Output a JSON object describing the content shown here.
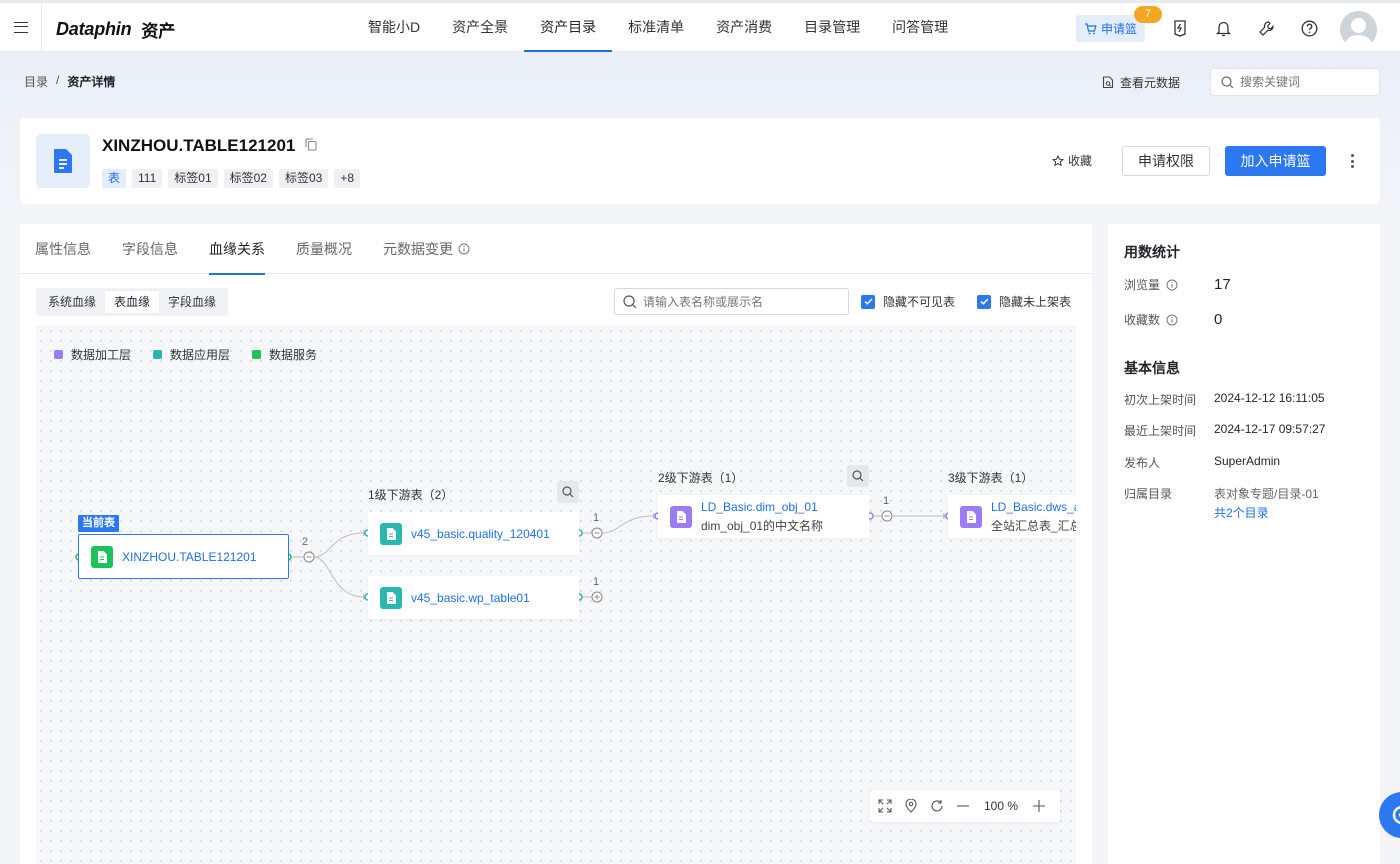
{
  "brand": {
    "name": "Dataphin",
    "sub": "资产"
  },
  "nav": {
    "items": [
      "智能小D",
      "资产全景",
      "资产目录",
      "标准清单",
      "资产消费",
      "目录管理",
      "问答管理"
    ],
    "active": "资产目录"
  },
  "toolbar": {
    "cart_label": "申请篮",
    "cart_badge": "7"
  },
  "breadcrumb": {
    "root": "目录",
    "sep": "/",
    "current": "资产详情"
  },
  "meta_link": "查看元数据",
  "top_search": {
    "placeholder": "搜索关键词"
  },
  "asset": {
    "title": "XINZHOU.TABLE121201",
    "tags": [
      "表",
      "111",
      "标签01",
      "标签02",
      "标签03",
      "+8"
    ],
    "fav_label": "收藏",
    "perm_label": "申请权限",
    "add_label": "加入申请篮"
  },
  "tabs": [
    "属性信息",
    "字段信息",
    "血缘关系",
    "质量概况",
    "元数据变更"
  ],
  "active_tab": "血缘关系",
  "lineage_modes": [
    "系统血缘",
    "表血缘",
    "字段血缘"
  ],
  "active_mode": "表血缘",
  "graph_search": {
    "placeholder": "请输入表名称或展示名"
  },
  "checks": {
    "hide_invisible": "隐藏不可见表",
    "hide_unlisted": "隐藏未上架表"
  },
  "legend": [
    {
      "label": "数据加工层",
      "color": "#9b7cf4"
    },
    {
      "label": "数据应用层",
      "color": "#2ab7b0"
    },
    {
      "label": "数据服务",
      "color": "#1ec25a"
    }
  ],
  "graph": {
    "current_label": "当前表",
    "current_node": "XINZHOU.TABLE121201",
    "level1": {
      "title": "1级下游表（2）",
      "nodes": [
        "v45_basic.quality_120401",
        "v45_basic.wp_table01"
      ]
    },
    "level2": {
      "title": "2级下游表（1）",
      "node_name": "LD_Basic.dim_obj_01",
      "node_sub": "dim_obj_01的中文名称"
    },
    "level3": {
      "title": "3级下游表（1）",
      "node_name": "LD_Basic.dws_a",
      "node_sub": "全站汇总表_汇总"
    },
    "counts": {
      "root": "2",
      "quality": "1",
      "wp": "1",
      "dim": "1"
    }
  },
  "zoom": {
    "value": "100",
    "unit": "%"
  },
  "usage": {
    "title": "用数统计",
    "views_label": "浏览量",
    "views": "17",
    "favs_label": "收藏数",
    "favs": "0"
  },
  "basic": {
    "title": "基本信息",
    "first_listed_label": "初次上架时间",
    "first_listed": "2024-12-12 16:11:05",
    "last_listed_label": "最近上架时间",
    "last_listed": "2024-12-17 09:57:27",
    "publisher_label": "发布人",
    "publisher": "SuperAdmin",
    "catalog_label": "归属目录",
    "catalog": "表对象专题/目录-01",
    "catalog_link": "共2个目录"
  }
}
